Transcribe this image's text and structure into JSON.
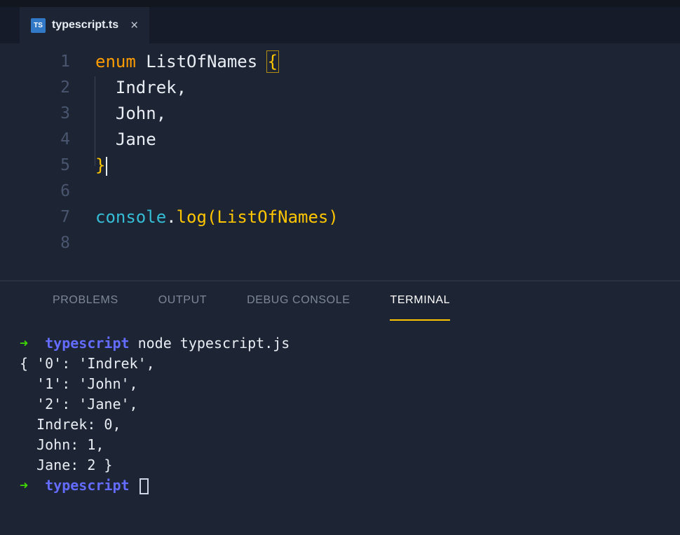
{
  "tab_bar": {
    "tabs": [
      {
        "icon": "TS",
        "label": "typescript.ts",
        "close": "×",
        "active": true
      }
    ]
  },
  "editor": {
    "lines": [
      {
        "num": "1",
        "tokens": [
          [
            "kw",
            "enum"
          ],
          [
            "plain",
            " ListOfNames "
          ],
          [
            "brace-box",
            "{"
          ]
        ]
      },
      {
        "num": "2",
        "tokens": [
          [
            "plain",
            "  Indrek,"
          ]
        ]
      },
      {
        "num": "3",
        "tokens": [
          [
            "plain",
            "  John,"
          ]
        ]
      },
      {
        "num": "4",
        "tokens": [
          [
            "plain",
            "  Jane"
          ]
        ]
      },
      {
        "num": "5",
        "tokens": [
          [
            "brace",
            "}"
          ],
          [
            "cursor",
            ""
          ]
        ]
      },
      {
        "num": "6",
        "tokens": []
      },
      {
        "num": "7",
        "tokens": [
          [
            "cyan",
            "console"
          ],
          [
            "plain",
            "."
          ],
          [
            "gold",
            "log"
          ],
          [
            "gold",
            "("
          ],
          [
            "gold",
            "ListOfNames"
          ],
          [
            "gold",
            ")"
          ]
        ]
      },
      {
        "num": "8",
        "tokens": []
      }
    ]
  },
  "panel": {
    "tabs": [
      {
        "label": "PROBLEMS",
        "active": false
      },
      {
        "label": "OUTPUT",
        "active": false
      },
      {
        "label": "DEBUG CONSOLE",
        "active": false
      },
      {
        "label": "TERMINAL",
        "active": true
      }
    ]
  },
  "terminal": {
    "lines": [
      {
        "tokens": [
          [
            "arrow",
            "➜"
          ],
          [
            "plain",
            "  "
          ],
          [
            "name",
            "typescript"
          ],
          [
            "plain",
            " node typescript.js"
          ]
        ]
      },
      {
        "tokens": [
          [
            "plain",
            "{ '0': 'Indrek',"
          ]
        ]
      },
      {
        "tokens": [
          [
            "plain",
            "  '1': 'John',"
          ]
        ]
      },
      {
        "tokens": [
          [
            "plain",
            "  '2': 'Jane',"
          ]
        ]
      },
      {
        "tokens": [
          [
            "plain",
            "  Indrek: 0,"
          ]
        ]
      },
      {
        "tokens": [
          [
            "plain",
            "  John: 1,"
          ]
        ]
      },
      {
        "tokens": [
          [
            "plain",
            "  Jane: 2 }"
          ]
        ]
      },
      {
        "tokens": [
          [
            "arrow",
            "➜"
          ],
          [
            "plain",
            "  "
          ],
          [
            "name",
            "typescript"
          ],
          [
            "plain",
            " "
          ],
          [
            "cursor-hollow",
            ""
          ]
        ]
      }
    ]
  },
  "colors": {
    "editor_background": "#1d2433",
    "tab_bar_background": "#151b28",
    "accent_yellow": "#ffc600",
    "keyword_orange": "#ff9d00",
    "console_cyan": "#35bdd6",
    "prompt_arrow_green": "#3fd900",
    "prompt_name_blue": "#646cff",
    "terminal_text": "#cfd6e4",
    "line_number_gray": "#4a5670",
    "ts_icon_blue": "#3178c6"
  }
}
